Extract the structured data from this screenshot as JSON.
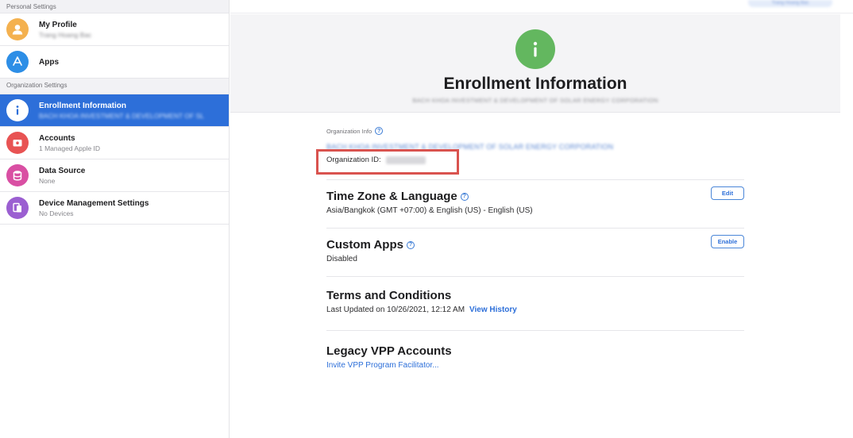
{
  "sidebar": {
    "personal_header": "Personal Settings",
    "org_header": "Organization Settings",
    "personal_items": [
      {
        "label": "My Profile",
        "sub": "Trang Hoang Bac",
        "icon": "person-icon",
        "color": "#f4b14f"
      },
      {
        "label": "Apps",
        "sub": "",
        "icon": "app-store-icon",
        "color": "#2d8ee6"
      }
    ],
    "org_items": [
      {
        "label": "Enrollment Information",
        "sub": "BACH KHOA INVESTMENT & DEVELOPMENT OF SL",
        "icon": "info-icon",
        "color": "#2d6fd9",
        "active": true
      },
      {
        "label": "Accounts",
        "sub": "1 Managed Apple ID",
        "icon": "accounts-icon",
        "color": "#e85353"
      },
      {
        "label": "Data Source",
        "sub": "None",
        "icon": "database-icon",
        "color": "#d94fa3"
      },
      {
        "label": "Device Management Settings",
        "sub": "No Devices",
        "icon": "devices-icon",
        "color": "#9b5fd1"
      }
    ]
  },
  "topbar": {
    "user": "Trang Hoang Bac"
  },
  "hero": {
    "icon": "info-icon",
    "icon_color": "#63b75f",
    "title": "Enrollment Information",
    "subtitle": "BACH KHOA INVESTMENT & DEVELOPMENT OF SOLAR ENERGY CORPORATION"
  },
  "org_info": {
    "label": "Organization Info",
    "name": "BACH KHOA INVESTMENT & DEVELOPMENT OF SOLAR ENERGY CORPORATION",
    "id_label": "Organization ID:",
    "highlight_color": "#d9534f"
  },
  "sections": {
    "timezone": {
      "title": "Time Zone & Language",
      "value": "Asia/Bangkok (GMT +07:00) & English (US) - English (US)",
      "button": "Edit"
    },
    "custom_apps": {
      "title": "Custom Apps",
      "value": "Disabled",
      "button": "Enable"
    },
    "terms": {
      "title": "Terms and Conditions",
      "value": "Last Updated on 10/26/2021, 12:12 AM",
      "link": "View History"
    },
    "legacy_vpp": {
      "title": "Legacy VPP Accounts",
      "link": "Invite VPP Program Facilitator..."
    }
  }
}
